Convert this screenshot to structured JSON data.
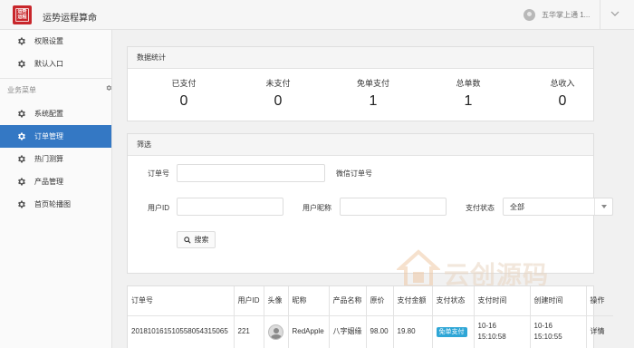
{
  "header": {
    "logo_text": [
      "运势",
      "运程"
    ],
    "title": "运势运程算命",
    "user": "五华掌上通 1...",
    "colors": {
      "logo": "#c8262b",
      "accent": "#3478c4"
    }
  },
  "sidebar": {
    "top_items": [
      {
        "label": "权限设置",
        "icon": "gear-icon"
      },
      {
        "label": "默认入口",
        "icon": "gear-icon"
      }
    ],
    "section_label": "业务菜单",
    "items": [
      {
        "label": "系统配置",
        "icon": "gear-icon",
        "active": false
      },
      {
        "label": "订单管理",
        "icon": "gear-icon",
        "active": true
      },
      {
        "label": "热门测算",
        "icon": "gear-icon",
        "active": false
      },
      {
        "label": "产品管理",
        "icon": "gear-icon",
        "active": false
      },
      {
        "label": "首页轮播图",
        "icon": "gear-icon",
        "active": false
      }
    ]
  },
  "stats": {
    "title": "数据统计",
    "items": [
      {
        "label": "已支付",
        "value": "0"
      },
      {
        "label": "未支付",
        "value": "0"
      },
      {
        "label": "免单支付",
        "value": "1"
      },
      {
        "label": "总单数",
        "value": "1"
      },
      {
        "label": "总收入",
        "value": "0"
      }
    ]
  },
  "filter": {
    "title": "筛选",
    "order_no_label": "订单号",
    "order_no_value": "",
    "wechat_order_label": "微信订单号",
    "user_id_label": "用户ID",
    "user_id_value": "",
    "nickname_label": "用户昵称",
    "nickname_value": "",
    "pay_status_label": "支付状态",
    "pay_status_value": "全部",
    "search_label": "搜索"
  },
  "table": {
    "headers": [
      "订单号",
      "用户ID",
      "头像",
      "昵称",
      "产品名称",
      "原价",
      "支付金额",
      "支付状态",
      "支付时间",
      "创建时间",
      "操作"
    ],
    "rows": [
      {
        "order_no": "2018101615105580543150​65",
        "user_id": "221",
        "nickname": "RedApple",
        "product": "八字姻缘",
        "price": "98.00",
        "paid": "19.80",
        "status": "免单支付",
        "pay_time": "10-16 15:10:58",
        "create_time": "10-16 15:10:55",
        "action": "详情"
      }
    ]
  },
  "watermark": {
    "text": "云创源码",
    "sub": "LOOWP.COM"
  }
}
